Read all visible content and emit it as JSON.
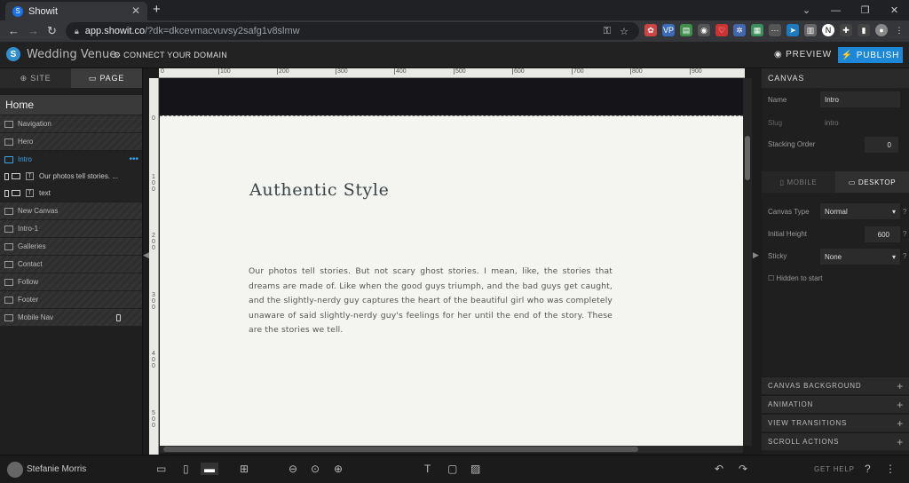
{
  "browser": {
    "tab_title": "Showit",
    "url_host": "app.showit.co",
    "url_rest": "/?dk=dkcevmacvuvsy2safg1v8slmw"
  },
  "header": {
    "site_name": "Wedding Venue",
    "connect_domain": "CONNECT YOUR DOMAIN",
    "preview": "PREVIEW",
    "publish": "PUBLISH"
  },
  "left": {
    "tab_site": "SITE",
    "tab_page": "PAGE",
    "page_title": "Home",
    "canvases": [
      "Navigation",
      "Hero",
      "Intro"
    ],
    "intro_children": [
      "Our photos tell stories. ...",
      "text"
    ],
    "more_canvases": [
      "New Canvas",
      "Intro-1",
      "Galleries",
      "Contact",
      "Follow",
      "Footer",
      "Mobile Nav"
    ]
  },
  "canvas": {
    "ruler_top": [
      "0",
      "100",
      "200",
      "300",
      "400",
      "500",
      "600",
      "700",
      "800",
      "900"
    ],
    "ruler_left": [
      "0",
      "100",
      "200",
      "300",
      "400",
      "500"
    ],
    "heading": "Authentic Style",
    "body": "Our photos tell stories. But not scary ghost stories. I mean, like, the stories that dreams are made of. Like when the good guys triumph, and the bad guys get caught, and the slightly-nerdy guy captures the heart of the beautiful girl who was completely unaware of said slightly-nerdy guy's feelings for her until the end of the story. These are the stories we tell."
  },
  "right": {
    "header": "CANVAS",
    "name_label": "Name",
    "name_value": "Intro",
    "slug_label": "Slug",
    "slug_value": "intro",
    "stacking_label": "Stacking Order",
    "stacking_value": "0",
    "tab_mobile": "MOBILE",
    "tab_desktop": "DESKTOP",
    "canvas_type_label": "Canvas Type",
    "canvas_type_value": "Normal",
    "initial_height_label": "Initial Height",
    "initial_height_value": "600",
    "sticky_label": "Sticky",
    "sticky_value": "None",
    "hidden_label": "Hidden to start",
    "sections": [
      "CANVAS BACKGROUND",
      "ANIMATION",
      "VIEW TRANSITIONS",
      "SCROLL ACTIONS"
    ]
  },
  "bottom": {
    "user": "Stefanie Morris",
    "help": "GET HELP"
  }
}
